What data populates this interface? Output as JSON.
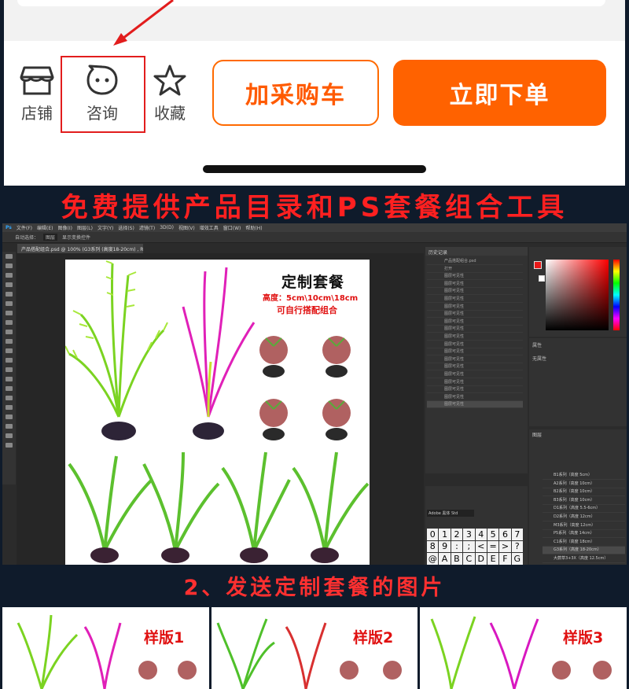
{
  "action_bar": {
    "store_label": "店铺",
    "chat_label": "咨询",
    "favorite_label": "收藏",
    "cart_button": "加采购车",
    "buy_button": "立即下单"
  },
  "banner_top": "免费提供产品目录和PS套餐组合工具",
  "photoshop": {
    "menu": [
      "文件(F)",
      "编辑(E)",
      "图像(I)",
      "图层(L)",
      "文字(Y)",
      "选择(S)",
      "滤镜(T)",
      "3D(D)",
      "视图(V)",
      "增效工具",
      "窗口(W)",
      "帮助(H)"
    ],
    "options": [
      "自动选择：",
      "图层",
      "显示变换控件"
    ],
    "doc_tab": "产品搭配组合.psd @ 100% (G3系列 (高度18-20cm) , RGB/8#) *",
    "history_header": "历史记录",
    "history_items": [
      "产品搭配组合.psd",
      "打开",
      "图层可见性",
      "图层可见性",
      "图层可见性",
      "图层可见性",
      "图层可见性",
      "图层可见性",
      "图层可见性",
      "图层可见性",
      "图层可见性",
      "图层可见性",
      "图层可见性",
      "图层可见性",
      "图层可见性",
      "图层可见性",
      "图层可见性",
      "图层可见性",
      "图层可见性",
      "图层可见性"
    ],
    "glyph_font": "Adobe 黑体 Std",
    "glyphs": [
      "0",
      "1",
      "2",
      "3",
      "4",
      "5",
      "6",
      "7",
      "8",
      "9",
      ":",
      ";",
      "<",
      "=",
      ">",
      "?",
      "@",
      "A",
      "B",
      "C",
      "D",
      "E",
      "F",
      "G"
    ],
    "props_header": "属性",
    "props_text": "无属性",
    "layers_header": "图层",
    "layers": [
      "B1系列（高度 5cm）",
      "A2系列（高度 10cm）",
      "B2系列（高度 10cm）",
      "B3系列（高度 10cm）",
      "D1系列（高度 5.5-6cm）",
      "D2系列（高度 12cm）",
      "M3系列（高度 12cm）",
      "P5系列（高度 14cm）",
      "C1系列（高度 18cm）",
      "G3系列（高度 18-20cm）",
      "大蕨草3+3X（高度 12.5cm）"
    ]
  },
  "canvas": {
    "title": "定制套餐",
    "subtitle1": "高度：5cm\\10cm\\18cm",
    "subtitle2": "可自行搭配组合"
  },
  "banner_step": "2、发送定制套餐的图片",
  "samples": [
    "样版1",
    "样版2",
    "样版3"
  ],
  "colors": {
    "accent_orange": "#ff6200",
    "banner_red": "#ff2020",
    "highlight_red": "#e21d1d",
    "background_navy": "#0f1b2b"
  }
}
